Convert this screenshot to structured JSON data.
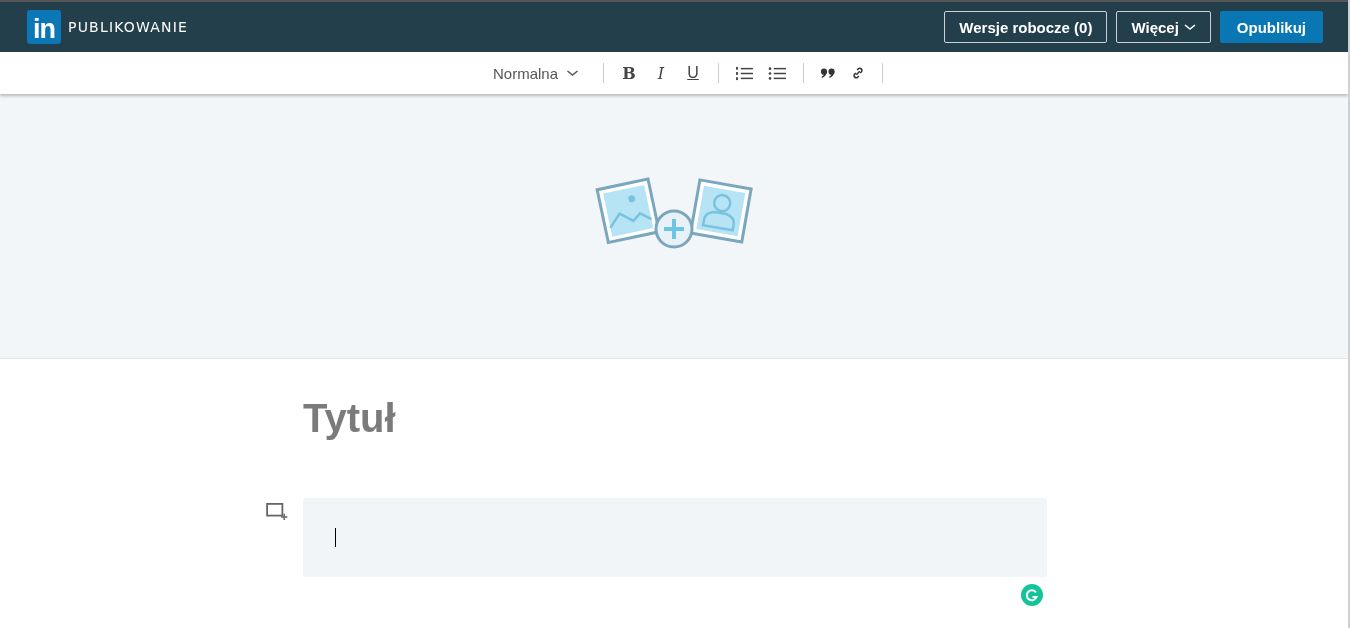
{
  "header": {
    "logo": "in",
    "title": "PUBLIKOWANIE",
    "buttons": [
      {
        "label": "Wersje robocze (0)",
        "kind": "outline"
      },
      {
        "label": "Więcej",
        "kind": "dropdown"
      },
      {
        "label": "Opublikuj",
        "kind": "primary"
      }
    ]
  },
  "toolbar": {
    "style": "Normalna",
    "groups": [
      [
        {
          "label": "B",
          "kind": "bold"
        },
        {
          "label": "I",
          "kind": "italic"
        },
        {
          "label": "U",
          "kind": "underline"
        }
      ],
      [
        {
          "kind": "ordered-list"
        },
        {
          "kind": "bullet-list"
        }
      ],
      [
        {
          "kind": "quote"
        },
        {
          "kind": "link"
        }
      ]
    ]
  },
  "article": {
    "title": {
      "placeholder": "Tytuł"
    }
  }
}
